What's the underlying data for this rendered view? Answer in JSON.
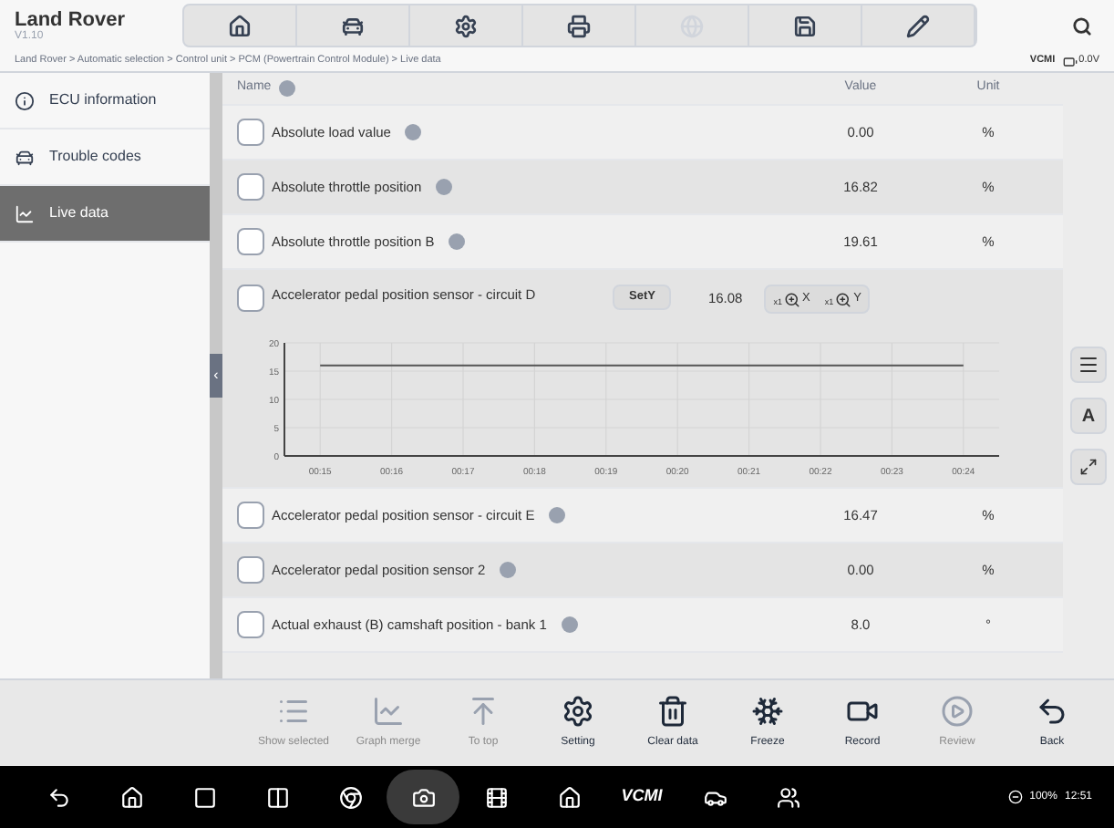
{
  "header": {
    "title": "Land Rover",
    "version": "V1.10",
    "toolbar": [
      {
        "disabled": false
      },
      {
        "disabled": false
      },
      {
        "disabled": false
      },
      {
        "disabled": false
      },
      {
        "disabled": true
      },
      {
        "disabled": false
      },
      {
        "disabled": false
      }
    ]
  },
  "breadcrumb": "Land Rover > Automatic selection > Control unit > PCM (Powertrain Control Module) > Live data",
  "status": {
    "vci": "VCMI",
    "voltage": "0.0V"
  },
  "sidebar": {
    "items": [
      {
        "label": "ECU information",
        "selected": false
      },
      {
        "label": "Trouble codes",
        "selected": false
      },
      {
        "label": "Live data",
        "selected": true
      }
    ]
  },
  "panel_toggle": "‹",
  "table": {
    "columns": [
      "Name",
      "Value",
      "Unit"
    ],
    "rows": [
      {
        "kind": "plain",
        "name": "Absolute load value",
        "value": "0.00",
        "unit": "%",
        "checked": false
      },
      {
        "kind": "plain",
        "name": "Absolute throttle position",
        "value": "16.82",
        "unit": "%",
        "checked": false
      },
      {
        "kind": "plain",
        "name": "Absolute throttle position B",
        "value": "19.61",
        "unit": "%",
        "checked": false
      },
      {
        "kind": "graph",
        "name": "Accelerator pedal position sensor - circuit D",
        "value": "16.08",
        "checked": false,
        "set_button": "SetY",
        "zoom_x": {
          "factor": "x1",
          "label": "X"
        },
        "zoom_y": {
          "factor": "x1",
          "label": "Y"
        },
        "chart_data": {
          "type": "line",
          "grid": true,
          "categories": [
            "00:15",
            "00:16",
            "00:17",
            "00:18",
            "00:19",
            "00:20",
            "00:21",
            "00:22",
            "00:23",
            "00:24"
          ],
          "ylim": [
            0,
            20
          ],
          "yticks": [
            0,
            5,
            10,
            15,
            20
          ],
          "series": [
            {
              "color": "#555555",
              "values": [
                16,
                16,
                16,
                16,
                16,
                16,
                16,
                16,
                16,
                16
              ]
            }
          ]
        }
      },
      {
        "kind": "plain",
        "name": "Accelerator pedal position sensor - circuit E",
        "value": "16.47",
        "unit": "%",
        "checked": false
      },
      {
        "kind": "plain",
        "name": "Accelerator pedal position sensor 2",
        "value": "0.00",
        "unit": "%",
        "checked": false
      },
      {
        "kind": "plain",
        "name": "Actual exhaust (B) camshaft position - bank 1",
        "value": "8.0",
        "unit": "°",
        "checked": false
      }
    ]
  },
  "side_buttons": [
    {
      "kind": "menu"
    },
    {
      "kind": "text",
      "label": "A"
    },
    {
      "kind": "expand"
    }
  ],
  "bottom_toolbar": [
    {
      "label": "Show selected",
      "disabled": true
    },
    {
      "label": "Graph merge",
      "disabled": true
    },
    {
      "label": "To top",
      "disabled": true
    },
    {
      "label": "Setting",
      "disabled": false
    },
    {
      "label": "Clear data",
      "disabled": false
    },
    {
      "label": "Freeze",
      "disabled": false
    },
    {
      "label": "Record",
      "disabled": false
    },
    {
      "label": "Review",
      "disabled": true
    },
    {
      "label": "Back",
      "disabled": false
    }
  ],
  "nav_bar": {
    "items": [
      {
        "selected": false
      },
      {
        "selected": false
      },
      {
        "selected": false
      },
      {
        "selected": false
      },
      {
        "selected": false
      },
      {
        "selected": true
      },
      {
        "selected": false
      },
      {
        "selected": false
      },
      {
        "label": "VCMI",
        "selected": false
      },
      {
        "selected": false
      },
      {
        "selected": false
      }
    ],
    "battery": "100%",
    "time": "12:51"
  }
}
